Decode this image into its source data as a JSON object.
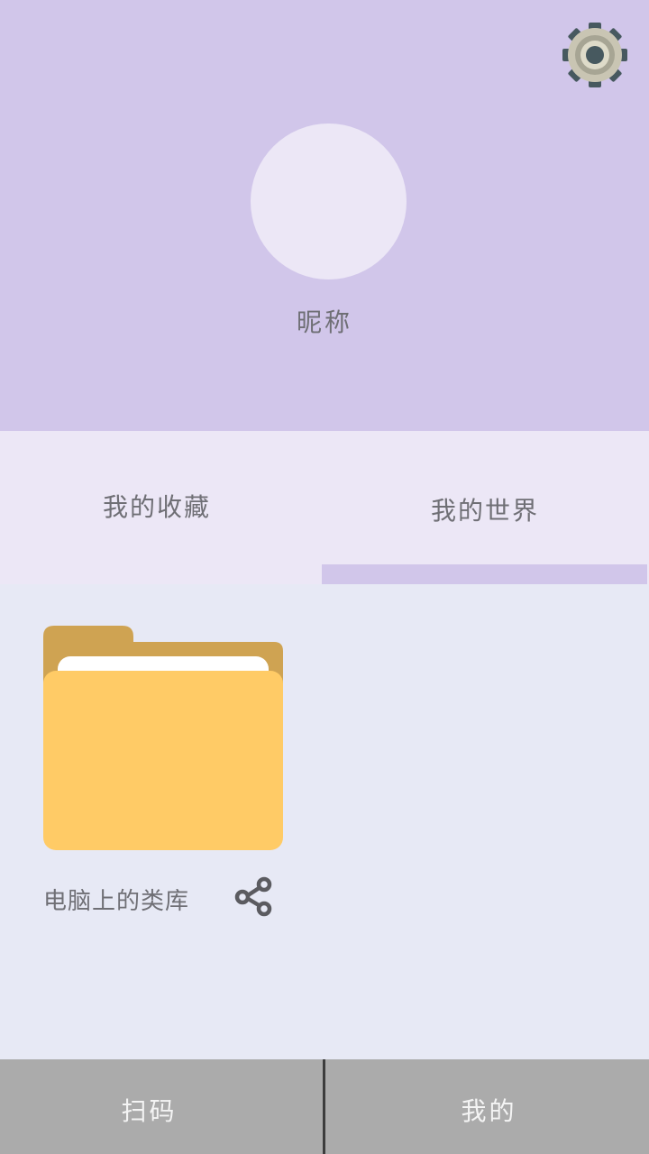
{
  "profile": {
    "nickname": "昵称"
  },
  "tabs": [
    {
      "label": "我的收藏"
    },
    {
      "label": "我的世界",
      "selected": true
    }
  ],
  "items": [
    {
      "name": "电脑上的类库",
      "icon": "folder-icon",
      "action_icon": "share-icon"
    }
  ],
  "bottom_nav": [
    {
      "label": "扫码"
    },
    {
      "label": "我的"
    }
  ],
  "icons": {
    "settings": "gear-icon",
    "folder": "folder-icon",
    "share": "share-icon"
  },
  "colors": {
    "header_bg": "#d1c6ea",
    "tab_bg": "#ece7f6",
    "content_bg": "#e7e9f5",
    "tab_indicator": "#d1c6ea",
    "folder_front": "#ffcb66",
    "folder_back": "#cfa352",
    "bottom_nav_bg": "#ababab",
    "text": "#6f6f75"
  }
}
